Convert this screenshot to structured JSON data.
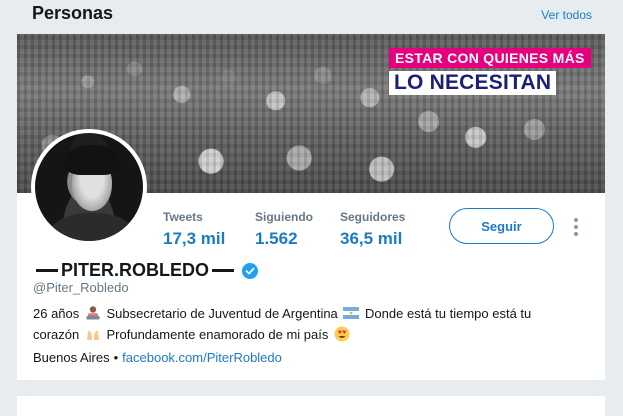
{
  "section": {
    "title": "Personas",
    "see_all": "Ver todos"
  },
  "banner": {
    "slogan_line1": "ESTAR CON QUIENES MÁS",
    "slogan_line2": "LO NECESITAN",
    "colors": {
      "pink": "#e6007e",
      "navy": "#1c1f78"
    }
  },
  "profile": {
    "name": "PITER.ROBLEDO",
    "handle": "@Piter_Robledo",
    "verified": true,
    "stats": [
      {
        "label": "Tweets",
        "value": "17,3 mil"
      },
      {
        "label": "Siguiendo",
        "value": "1.562"
      },
      {
        "label": "Seguidores",
        "value": "36,5 mil"
      }
    ],
    "follow_label": "Seguir",
    "bio_part1": "26 años",
    "bio_part2": "Subsecretario de Juventud de Argentina",
    "bio_part3": "Donde está tu tiempo está tu",
    "bio_part4": "corazón",
    "bio_part5": "Profundamente enamorado de mi país",
    "location": "Buenos Aires",
    "separator": "•",
    "link": "facebook.com/PiterRobledo"
  },
  "theme": {
    "accent": "#1b7cc4",
    "muted": "#657786",
    "background": "#e6ecf0"
  }
}
